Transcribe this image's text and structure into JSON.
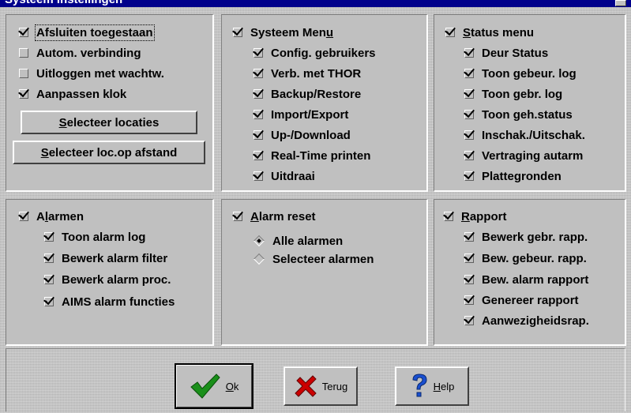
{
  "window": {
    "title": "Systeem instellingen"
  },
  "panels": {
    "general": {
      "items": [
        {
          "label": "Afsluiten toegestaan",
          "checked": true
        },
        {
          "label": "Autom. verbinding",
          "checked": false
        },
        {
          "label": "Uitloggen met wachtw.",
          "checked": false
        },
        {
          "label": "Aanpassen klok",
          "checked": true
        }
      ],
      "buttons": {
        "select_locations": {
          "prefix": "",
          "ul": "S",
          "rest": "electeer locaties"
        },
        "select_remote": {
          "prefix": "",
          "ul": "S",
          "rest": "electeer loc.op afstand"
        }
      }
    },
    "system_menu": {
      "header": {
        "pre": "Systeem Men",
        "ul": "u",
        "post": "",
        "checked": true
      },
      "items": [
        {
          "label": "Config. gebruikers",
          "checked": true
        },
        {
          "label": "Verb. met THOR",
          "checked": true
        },
        {
          "label": "Backup/Restore",
          "checked": true
        },
        {
          "label": "Import/Export",
          "checked": true
        },
        {
          "label": "Up-/Download",
          "checked": true
        },
        {
          "label": "Real-Time printen",
          "checked": true
        },
        {
          "label": "Uitdraai",
          "checked": true
        }
      ]
    },
    "status_menu": {
      "header": {
        "pre": "",
        "ul": "S",
        "post": "tatus menu",
        "checked": true
      },
      "items": [
        {
          "label": "Deur Status",
          "checked": true
        },
        {
          "label": "Toon gebeur. log",
          "checked": true
        },
        {
          "label": "Toon gebr. log",
          "checked": true
        },
        {
          "label": "Toon geh.status",
          "checked": true
        },
        {
          "label": "Inschak./Uitschak.",
          "checked": true
        },
        {
          "label": "Vertraging autarm",
          "checked": true
        },
        {
          "label": "Plattegronden",
          "checked": true
        }
      ]
    },
    "alarms": {
      "header": {
        "pre": "A",
        "ul": "l",
        "post": "armen",
        "checked": true
      },
      "items": [
        {
          "label": "Toon alarm log",
          "checked": true
        },
        {
          "label": "Bewerk alarm filter",
          "checked": true
        },
        {
          "label": "Bewerk alarm proc.",
          "checked": true
        },
        {
          "label": "AIMS alarm functies",
          "checked": true
        }
      ]
    },
    "alarm_reset": {
      "header": {
        "pre": "",
        "ul": "A",
        "post": "larm reset",
        "checked": true
      },
      "options": [
        {
          "label": "Alle alarmen",
          "selected": true
        },
        {
          "label": "Selecteer alarmen",
          "selected": false
        }
      ]
    },
    "report": {
      "header": {
        "pre": "",
        "ul": "R",
        "post": "apport",
        "checked": true
      },
      "items": [
        {
          "label": "Bewerk gebr. rapp.",
          "checked": true
        },
        {
          "label": "Bew. gebeur. rapp.",
          "checked": true
        },
        {
          "label": "Bew. alarm rapport",
          "checked": true
        },
        {
          "label": "Genereer rapport",
          "checked": true
        },
        {
          "label": "Aanwezigheidsrap.",
          "checked": true
        }
      ]
    }
  },
  "footer": {
    "ok": {
      "ul": "O",
      "rest": "k",
      "icon": "checkmark-icon"
    },
    "back": {
      "label": "Terug",
      "icon": "cross-icon"
    },
    "help": {
      "ul": "H",
      "rest": "elp",
      "icon": "question-icon"
    }
  },
  "colors": {
    "face": "#c0c0c0",
    "titlebar": "#00008b",
    "ok_icon": "#1a8f1a",
    "back_icon": "#cc0000",
    "help_icon": "#1a4fd0"
  }
}
